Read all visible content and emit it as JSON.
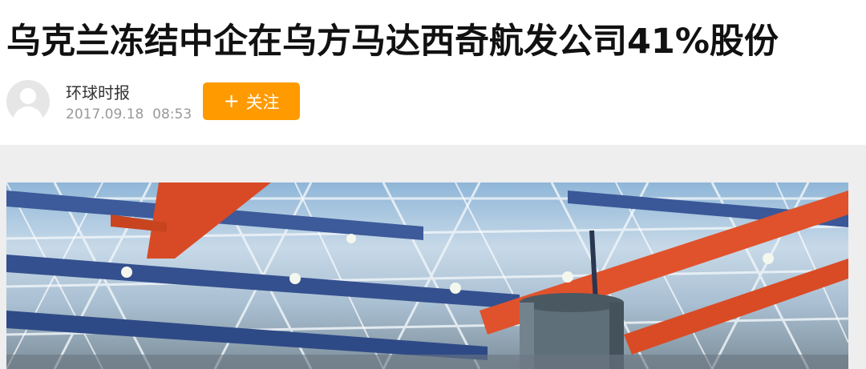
{
  "article": {
    "title": "乌克兰冻结中企在乌方马达西奇航发公司41%股份"
  },
  "author": {
    "name": "环球时报",
    "publish_time": "2017.09.18  08:53",
    "avatar_icon": "default-user-avatar"
  },
  "follow_button": {
    "icon": "plus-icon",
    "plus_symbol": "+",
    "label": "关注",
    "color": "#ff9a00"
  },
  "colors": {
    "background": "#ffffff",
    "band": "#eeeeee",
    "title": "#111111",
    "muted": "#999999"
  }
}
